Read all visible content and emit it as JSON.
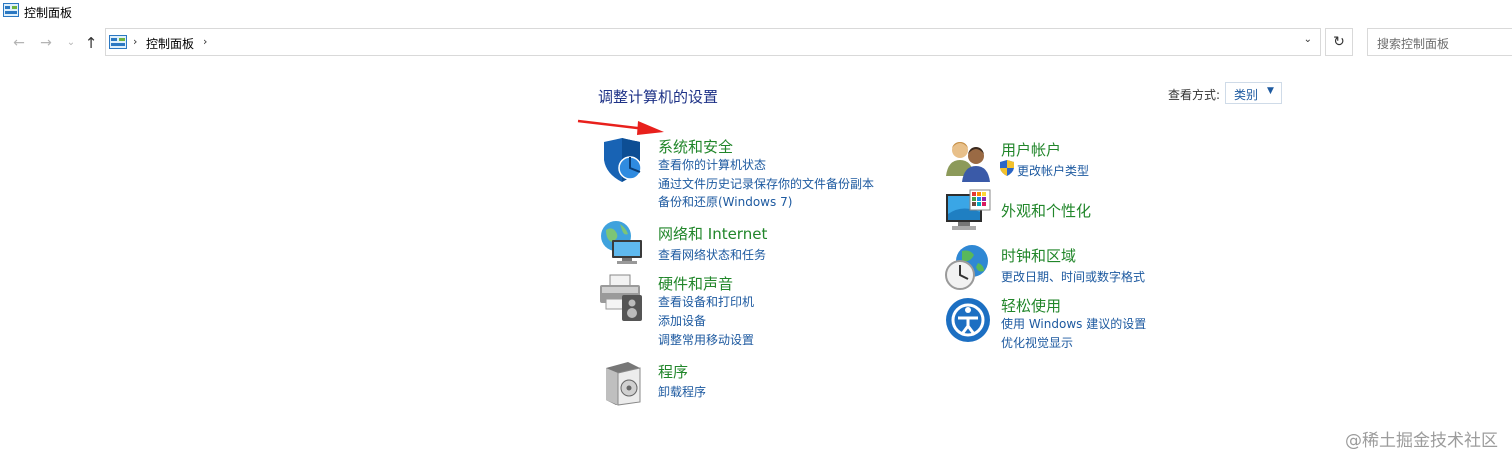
{
  "window": {
    "title": "控制面板"
  },
  "nav": {
    "back": "←",
    "forward": "→",
    "recent": "⌄",
    "up": "↑"
  },
  "address": {
    "sep1": "›",
    "crumb": "控制面板",
    "sep2": "›",
    "dropdown": "⌄",
    "refresh": "↻"
  },
  "search": {
    "placeholder": "搜索控制面板"
  },
  "main": {
    "heading": "调整计算机的设置",
    "view_by_label": "查看方式:",
    "view_by_value": "类别",
    "view_by_arrow": "▼"
  },
  "left_categories": [
    {
      "title": "系统和安全",
      "icon": "shield-icon",
      "links": [
        "查看你的计算机状态",
        "通过文件历史记录保存你的文件备份副本",
        "备份和还原(Windows 7)"
      ]
    },
    {
      "title": "网络和 Internet",
      "icon": "network-globe-icon",
      "links": [
        "查看网络状态和任务"
      ]
    },
    {
      "title": "硬件和声音",
      "icon": "printer-speaker-icon",
      "links": [
        "查看设备和打印机",
        "添加设备",
        "调整常用移动设置"
      ]
    },
    {
      "title": "程序",
      "icon": "programs-box-icon",
      "links": [
        "卸载程序"
      ]
    }
  ],
  "right_categories": [
    {
      "title": "用户帐户",
      "icon": "users-icon",
      "links": [
        "更改帐户类型"
      ]
    },
    {
      "title": "外观和个性化",
      "icon": "monitor-palette-icon",
      "links": []
    },
    {
      "title": "时钟和区域",
      "icon": "clock-globe-icon",
      "links": [
        "更改日期、时间或数字格式"
      ]
    },
    {
      "title": "轻松使用",
      "icon": "ease-of-access-icon",
      "links": [
        "使用 Windows 建议的设置",
        "优化视觉显示"
      ]
    }
  ],
  "watermark": "@稀土掘金技术社区",
  "colors": {
    "link": "#1e5aa0",
    "category_title": "#21862a",
    "heading": "#1e3287",
    "annotation_arrow": "#e8201c"
  }
}
